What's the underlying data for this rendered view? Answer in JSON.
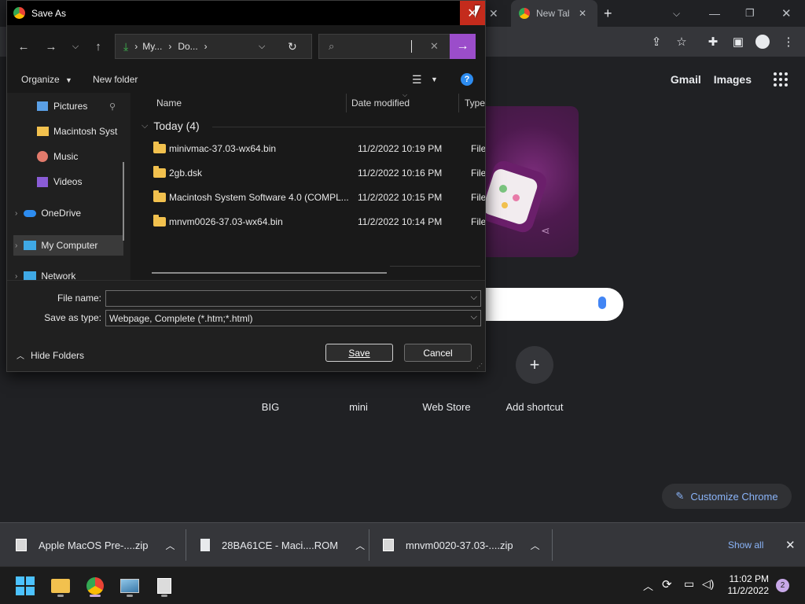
{
  "chrome": {
    "tabs": [
      {
        "label": "New Tab"
      }
    ],
    "links": {
      "gmail": "Gmail",
      "images": "Images"
    },
    "shortcuts": [
      {
        "label": "BIG"
      },
      {
        "label": "mini"
      },
      {
        "label": "Web Store"
      },
      {
        "label": "Add shortcut"
      }
    ],
    "customize_label": "Customize Chrome",
    "accent": "#8ab4f8"
  },
  "downloads": {
    "items": [
      {
        "name": "Apple MacOS Pre-....zip"
      },
      {
        "name": "28BA61CE - Maci....ROM"
      },
      {
        "name": "mnvm0020-37.03-....zip"
      }
    ],
    "show_all": "Show all"
  },
  "taskbar": {
    "time": "11:02 PM",
    "date": "11/2/2022",
    "notification_count": "2"
  },
  "dialog": {
    "title": "Save As",
    "breadcrumb": [
      "My...",
      "Do..."
    ],
    "organize": "Organize",
    "new_folder": "New folder",
    "nav_items": [
      {
        "label": "Pictures"
      },
      {
        "label": "Macintosh Syst"
      },
      {
        "label": "Music"
      },
      {
        "label": "Videos"
      },
      {
        "label": "OneDrive"
      },
      {
        "label": "My Computer"
      },
      {
        "label": "Network"
      }
    ],
    "columns": {
      "name": "Name",
      "date": "Date modified",
      "type": "Type"
    },
    "group_label": "Today (4)",
    "files": [
      {
        "name": "minivmac-37.03-wx64.bin",
        "date": "11/2/2022 10:19 PM",
        "type": "File fo"
      },
      {
        "name": "2gb.dsk",
        "date": "11/2/2022 10:16 PM",
        "type": "File fo"
      },
      {
        "name": "Macintosh System Software 4.0 (COMPL...",
        "date": "11/2/2022 10:15 PM",
        "type": "File fo"
      },
      {
        "name": "mnvm0026-37.03-wx64.bin",
        "date": "11/2/2022 10:14 PM",
        "type": "File fo"
      }
    ],
    "file_name_label": "File name:",
    "file_name_value": "",
    "save_type_label": "Save as type:",
    "save_type_value": "Webpage, Complete (*.htm;*.html)",
    "hide_folders": "Hide Folders",
    "save": "Save",
    "cancel": "Cancel",
    "close_color": "#c42b1c",
    "search_go_color": "#9b4dca"
  }
}
